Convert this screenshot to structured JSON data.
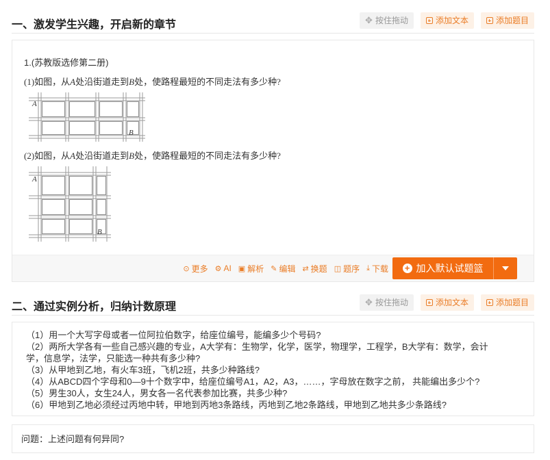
{
  "sections": [
    {
      "title": "一、激发学生兴趣，开启新的章节",
      "drag_label": "按住拖动",
      "add_text_label": "添加文本",
      "add_question_label": "添加题目"
    },
    {
      "title": "二、通过实例分析，归纳计数原理",
      "drag_label": "按住拖动",
      "add_text_label": "添加文本",
      "add_question_label": "添加题目"
    }
  ],
  "question": {
    "source": "1.(苏教版选修第二册)",
    "part1": {
      "prefix": "(1)如图，从",
      "a": "A",
      "mid": "处沿街道走到",
      "b": "B",
      "suffix": "处，使路程最短的不同走法有多少种?"
    },
    "part2": {
      "prefix": "(2)如图，从",
      "a": "A",
      "mid": "处沿街道走到",
      "b": "B",
      "suffix": "处，使路程最短的不同走法有多少种?"
    },
    "fig_label_a": "A",
    "fig_label_b": "B"
  },
  "toolbar": {
    "more": "更多",
    "ai": "AI",
    "analysis": "解析",
    "edit": "编辑",
    "swap": "换题",
    "order": "题序",
    "download": "下载",
    "add_basket": "加入默认试题篮"
  },
  "list_items": [
    "（1）用一个大写字母或者一位阿拉伯数字，给座位编号，能编多少个号码?",
    "（2）两所大学各有一些自己感兴趣的专业，A大学有：生物学，化学，医学，物理学，工程学，B大学有：数学，会计",
    "学，信息学，法学，只能选一种共有多少种?",
    "（3）从甲地到乙地，有火车3班，飞机2班，共多少种路线?",
    "（4）从ABCD四个字母和0—9十个数字中，给座位编号A1，A2，A3，……，字母放在数字之前， 共能编出多少个?",
    "（5）男生30人，女生24人，男女各一名代表参加比赛，共多少种?",
    "（6）甲地到乙地必须经过丙地中转，甲地到丙地3条路线，丙地到乙地2条路线，甲地到乙地共多少条路线?"
  ],
  "note": "问题：上述问题有何异同?"
}
